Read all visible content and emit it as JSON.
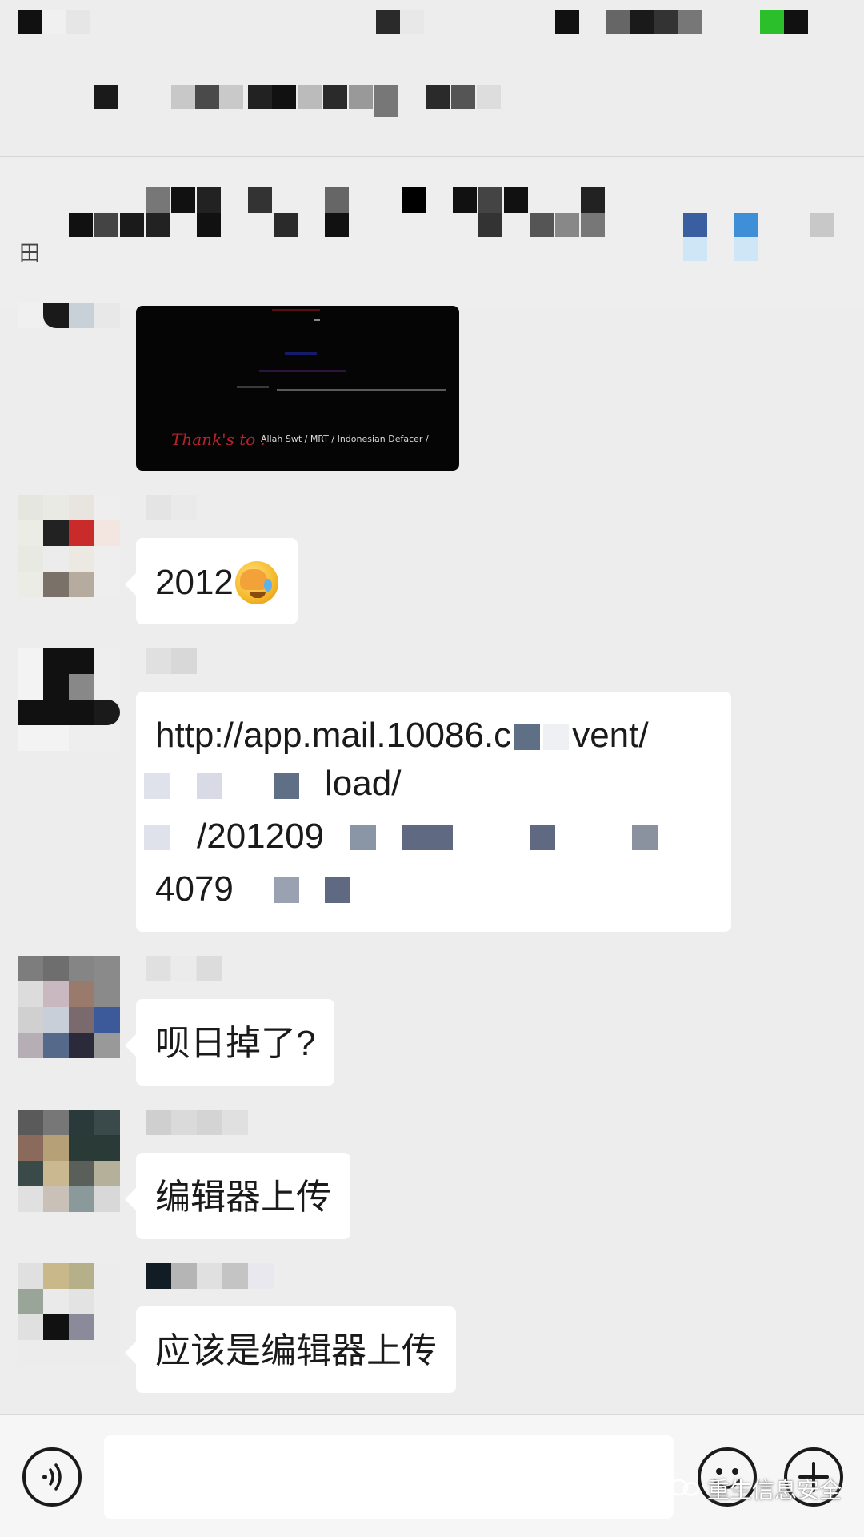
{
  "status_bar": {},
  "title_bar": {},
  "notice_bar": {
    "glyph": "田"
  },
  "messages": [
    {
      "type": "image",
      "sender_nickname": "",
      "image_text": "Thank's to :",
      "image_credits": "Allah Swt / MRT / Indonesian Defacer /"
    },
    {
      "type": "text",
      "text": "2012",
      "emoji": "face-with-hand-crying-emoji"
    },
    {
      "type": "link",
      "url_line1": "http://app.mail.10086.c",
      "url_line1_end": "vent/",
      "url_line2": "load/",
      "url_line3": "/201209",
      "url_line4": "4079"
    },
    {
      "type": "text",
      "text": "呗日掉了?"
    },
    {
      "type": "text",
      "text": "编辑器上传"
    },
    {
      "type": "text",
      "text": "应该是编辑器上传"
    }
  ],
  "input_bar": {
    "voice_icon": "voice-icon",
    "emoji_icon": "emoji-face-icon",
    "plus_icon": "plus-icon",
    "input_value": "",
    "input_placeholder": ""
  },
  "watermark": {
    "text": "重生信息安全"
  },
  "colors": {
    "background": "#ededed",
    "bubble": "#ffffff",
    "text": "#1a1a1a",
    "image_red": "#b8232b"
  }
}
